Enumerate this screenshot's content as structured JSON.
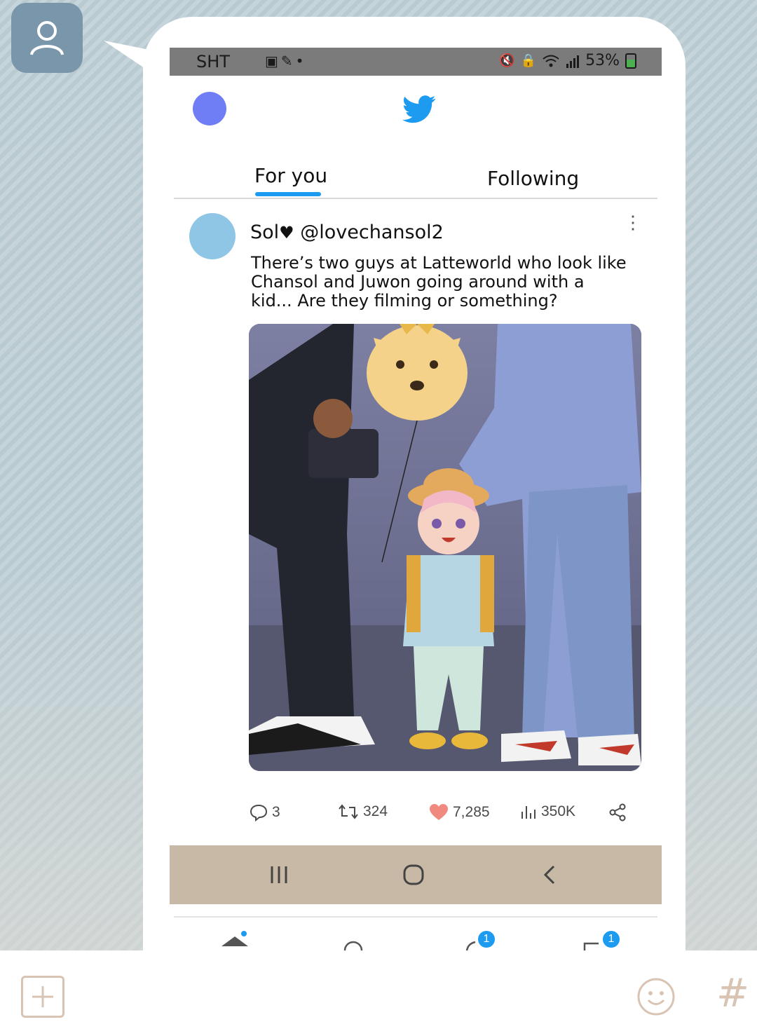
{
  "status_bar": {
    "carrier": "SHT",
    "left_icons": [
      "image-icon",
      "paperclip-icon",
      "dot-icon"
    ],
    "right_icons": [
      "mute-vibrate-icon",
      "lock-icon",
      "wifi-icon",
      "signal-icon"
    ],
    "battery_percent": "53%"
  },
  "header": {
    "logo": "twitter-bird-icon",
    "colors": {
      "user_avatar": "#6f7ef5",
      "brand": "#1d9bf0"
    }
  },
  "tabs": [
    {
      "label": "For you",
      "active": true
    },
    {
      "label": "Following",
      "active": false
    }
  ],
  "tweet": {
    "display_name": "Sol",
    "name_heart": "♥",
    "handle": "@lovechansol2",
    "text": "There’s two guys at Latteworld who look like Chansol and Juwon going around with a kid... Are they filming or something?",
    "stats": {
      "replies": "3",
      "retweets": "324",
      "likes": "7,285",
      "views": "350K"
    }
  },
  "bottom_nav": {
    "badges": {
      "notifications": "1",
      "messages": "1"
    }
  },
  "chat_input": {
    "icons": [
      "add-icon",
      "emoji-icon",
      "hashtag-icon"
    ],
    "hash_label": "#"
  }
}
